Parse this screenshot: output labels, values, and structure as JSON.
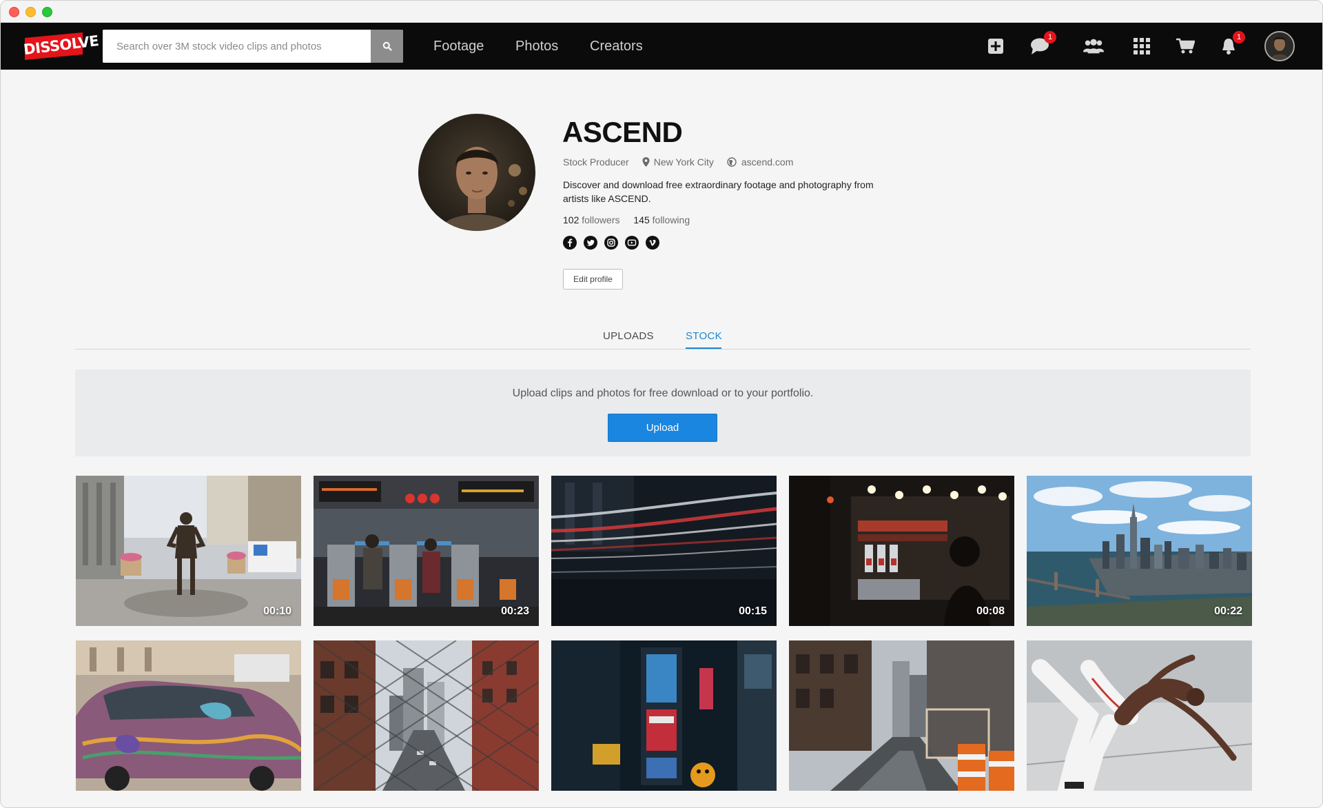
{
  "app": {
    "logo_text": "DISSOLVE",
    "brand_color": "#e4141b"
  },
  "header": {
    "search_placeholder": "Search over 3M stock video clips and photos",
    "nav": [
      "Footage",
      "Photos",
      "Creators"
    ],
    "icons": [
      {
        "name": "add-icon"
      },
      {
        "name": "messages-icon",
        "badge": "1"
      },
      {
        "name": "community-icon"
      },
      {
        "name": "apps-grid-icon"
      },
      {
        "name": "cart-icon"
      },
      {
        "name": "notifications-icon",
        "badge": "1"
      }
    ]
  },
  "profile": {
    "name": "ASCEND",
    "role": "Stock Producer",
    "location": "New York City",
    "website": "ascend.com",
    "bio": "Discover and download free extraordinary footage and photography from artists like ASCEND.",
    "followers_count": "102",
    "followers_label": "followers",
    "following_count": "145",
    "following_label": "following",
    "socials": [
      "facebook-icon",
      "twitter-icon",
      "instagram-icon",
      "youtube-icon",
      "vimeo-icon"
    ],
    "edit_label": "Edit profile"
  },
  "tabs": [
    {
      "label": "UPLOADS",
      "active": false
    },
    {
      "label": "STOCK",
      "active": true
    }
  ],
  "accent_color": "#1a86d6",
  "upload_panel": {
    "message": "Upload clips and photos for free download or to your portfolio.",
    "button_label": "Upload"
  },
  "media": [
    {
      "type": "video",
      "duration": "00:10"
    },
    {
      "type": "video",
      "duration": "00:23"
    },
    {
      "type": "video",
      "duration": "00:15"
    },
    {
      "type": "video",
      "duration": "00:08"
    },
    {
      "type": "video",
      "duration": "00:22"
    },
    {
      "type": "photo"
    },
    {
      "type": "photo"
    },
    {
      "type": "photo"
    },
    {
      "type": "photo"
    },
    {
      "type": "photo"
    }
  ]
}
